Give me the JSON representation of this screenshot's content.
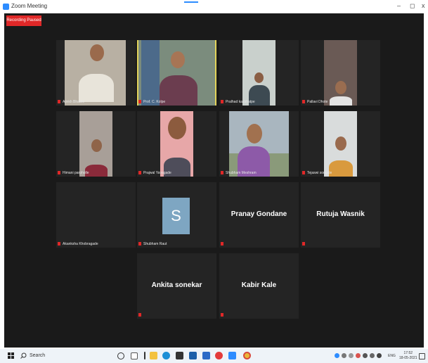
{
  "window": {
    "title": "Zoom Meeting",
    "minimize": "–",
    "maximize": "◻",
    "close": "x"
  },
  "recording": {
    "label": "Recording Paused",
    "color": "#e02828"
  },
  "participants": [
    {
      "name": "Ajinkh Bhadre"
    },
    {
      "name": "Prof. C. Kolpe"
    },
    {
      "name": "Pralhad kasbhatpe"
    },
    {
      "name": "Pallavi Dhote"
    },
    {
      "name": "Himani parpholle"
    },
    {
      "name": "Prajwal Yavagade"
    },
    {
      "name": "Shubham Meshram"
    },
    {
      "name": "Tejaswi songale"
    },
    {
      "name": "Akanksha Khobragade"
    },
    {
      "name": "Shubham Raut",
      "avatar_letter": "S"
    },
    {
      "display_name": "Pranay Gondane"
    },
    {
      "display_name": "Rutuja Wasnik"
    },
    {
      "display_name": "Ankita  sonekar"
    },
    {
      "display_name": "Kabir Kale"
    }
  ],
  "taskbar": {
    "search_label": "Search",
    "icons": [
      "start-icon",
      "search-icon",
      "cortana-icon",
      "task-view-icon",
      "file-explorer-icon",
      "edge-icon",
      "dropbox-icon",
      "mail-icon",
      "word-icon",
      "opera-icon",
      "zoom-icon",
      "chrome-icon"
    ],
    "language": "ENG",
    "time": "17:52",
    "date": "18-05-2021"
  }
}
